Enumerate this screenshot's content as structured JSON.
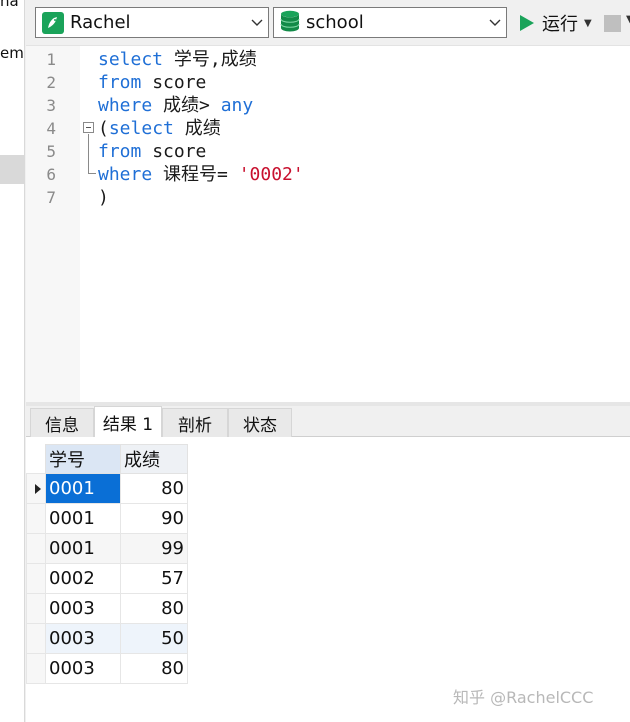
{
  "sidebar": {
    "frag_top": "na",
    "frag_mid": "ema"
  },
  "toolbar": {
    "connection": "Rachel",
    "database": "school",
    "run_label": "运行",
    "colors": {
      "run": "#1aa35a",
      "connection_icon": "#1aa35a",
      "database_icon": "#1aa35a"
    }
  },
  "editor": {
    "lines": [
      {
        "num": "1",
        "tokens": [
          {
            "t": "select",
            "k": "kw"
          },
          {
            "t": " 学号,成绩",
            "k": "tx"
          }
        ]
      },
      {
        "num": "2",
        "tokens": [
          {
            "t": "from",
            "k": "kw"
          },
          {
            "t": " score",
            "k": "tx"
          }
        ]
      },
      {
        "num": "3",
        "tokens": [
          {
            "t": "where",
            "k": "kw"
          },
          {
            "t": " 成绩> ",
            "k": "tx"
          },
          {
            "t": "any",
            "k": "kw"
          }
        ]
      },
      {
        "num": "4",
        "tokens": [
          {
            "t": "(",
            "k": "tx"
          },
          {
            "t": "select",
            "k": "kw"
          },
          {
            "t": " 成绩",
            "k": "tx"
          }
        ]
      },
      {
        "num": "5",
        "tokens": [
          {
            "t": "from",
            "k": "kw"
          },
          {
            "t": " score",
            "k": "tx"
          }
        ]
      },
      {
        "num": "6",
        "tokens": [
          {
            "t": "where",
            "k": "kw"
          },
          {
            "t": " 课程号= ",
            "k": "tx"
          },
          {
            "t": "'0002'",
            "k": "str"
          }
        ]
      },
      {
        "num": "7",
        "tokens": [
          {
            "t": ")",
            "k": "tx"
          }
        ]
      }
    ],
    "colors": {
      "keyword": "#1f6fd6",
      "string": "#c8102e",
      "text": "#1a1a1a"
    }
  },
  "tabs": [
    {
      "label": "信息",
      "active": false
    },
    {
      "label": "结果 1",
      "active": true
    },
    {
      "label": "剖析",
      "active": false
    },
    {
      "label": "状态",
      "active": false
    }
  ],
  "results": {
    "columns": [
      "学号",
      "成绩"
    ],
    "rows": [
      [
        "0001",
        "80"
      ],
      [
        "0001",
        "90"
      ],
      [
        "0001",
        "99"
      ],
      [
        "0002",
        "57"
      ],
      [
        "0003",
        "80"
      ],
      [
        "0003",
        "50"
      ],
      [
        "0003",
        "80"
      ]
    ],
    "selected_row": 0
  },
  "watermark": "知乎 @RachelCCC"
}
